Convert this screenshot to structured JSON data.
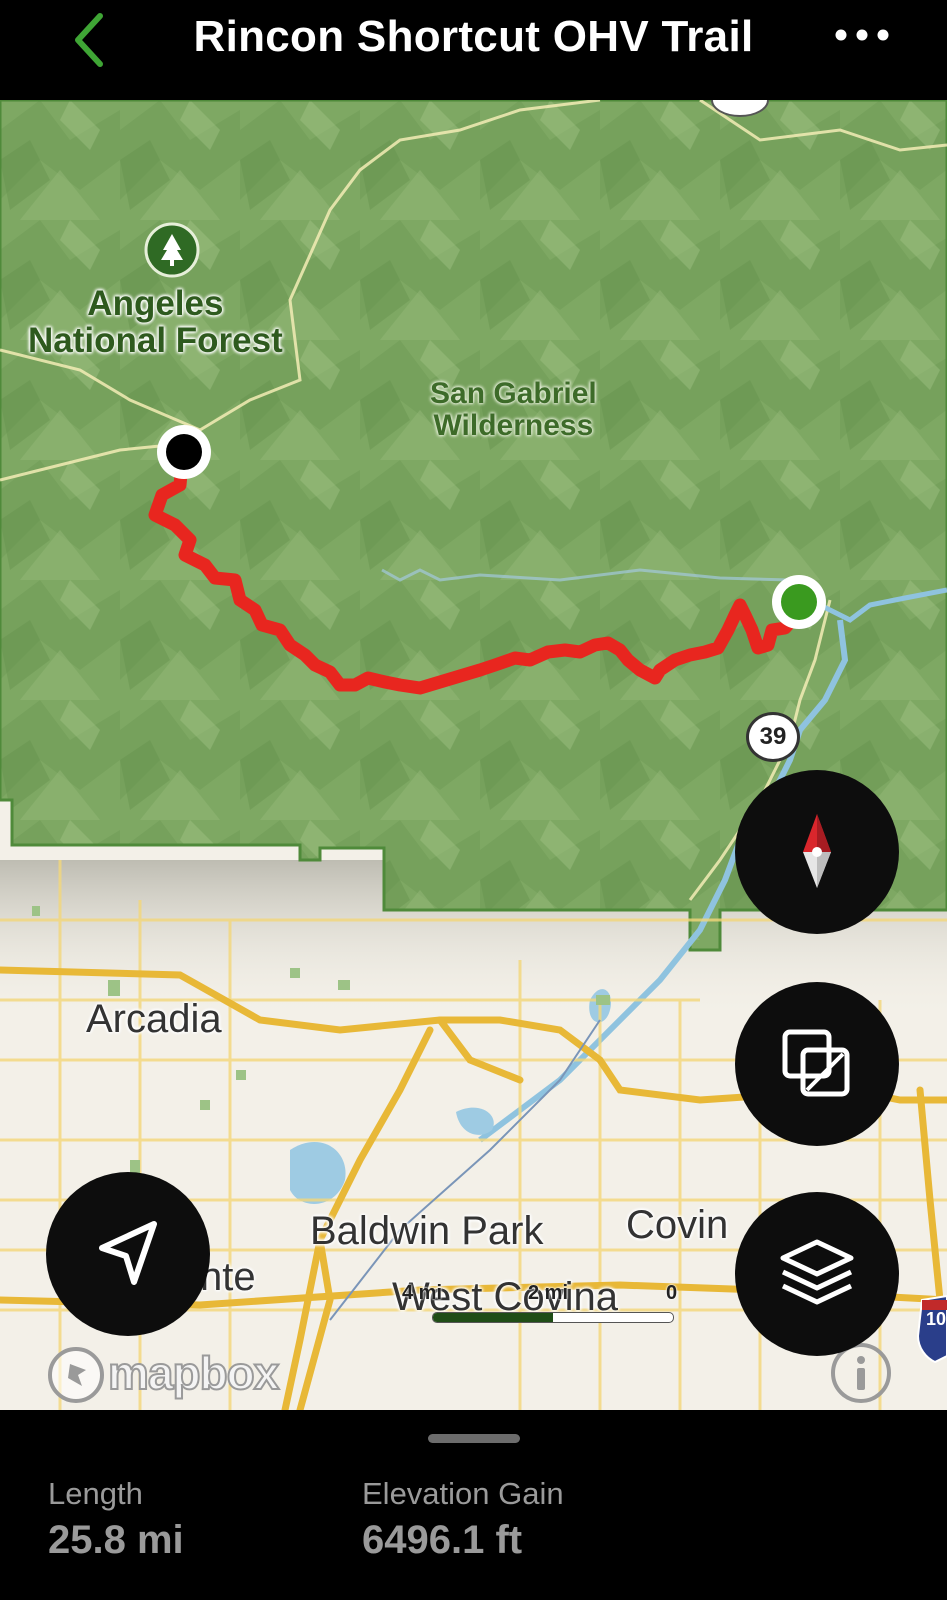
{
  "header": {
    "title": "Rincon Shortcut OHV Trail",
    "back_icon": "chevron-left-icon",
    "more_icon": "ellipsis-icon"
  },
  "map": {
    "labels": {
      "forest_line1": "Angeles",
      "forest_line2": "National Forest",
      "wilderness_line1": "San Gabriel",
      "wilderness_line2": "Wilderness",
      "arcadia": "Arcadia",
      "baldwin_park": "Baldwin Park",
      "covina_partial": "Covin",
      "monte_partial": "nte",
      "west_covina": "West Covina"
    },
    "highway_shield": "39",
    "interstate_partial": "10",
    "scale": {
      "left": "4 mi",
      "mid": "2 mi",
      "right": "0"
    },
    "attribution": "mapbox",
    "colors": {
      "forest": "#7fa862",
      "route": "#e8261f",
      "start_marker": "#3a9a1f",
      "end_marker": "#000000",
      "road": "#f2c94c"
    }
  },
  "controls": {
    "compass_icon": "compass-icon",
    "map_style_icon": "overlapping-squares-icon",
    "layers_icon": "layers-icon",
    "locate_icon": "navigation-arrow-icon",
    "info_icon": "info-icon"
  },
  "stats": {
    "length_label": "Length",
    "length_value": "25.8 mi",
    "elevation_label": "Elevation Gain",
    "elevation_value": "6496.1 ft"
  }
}
